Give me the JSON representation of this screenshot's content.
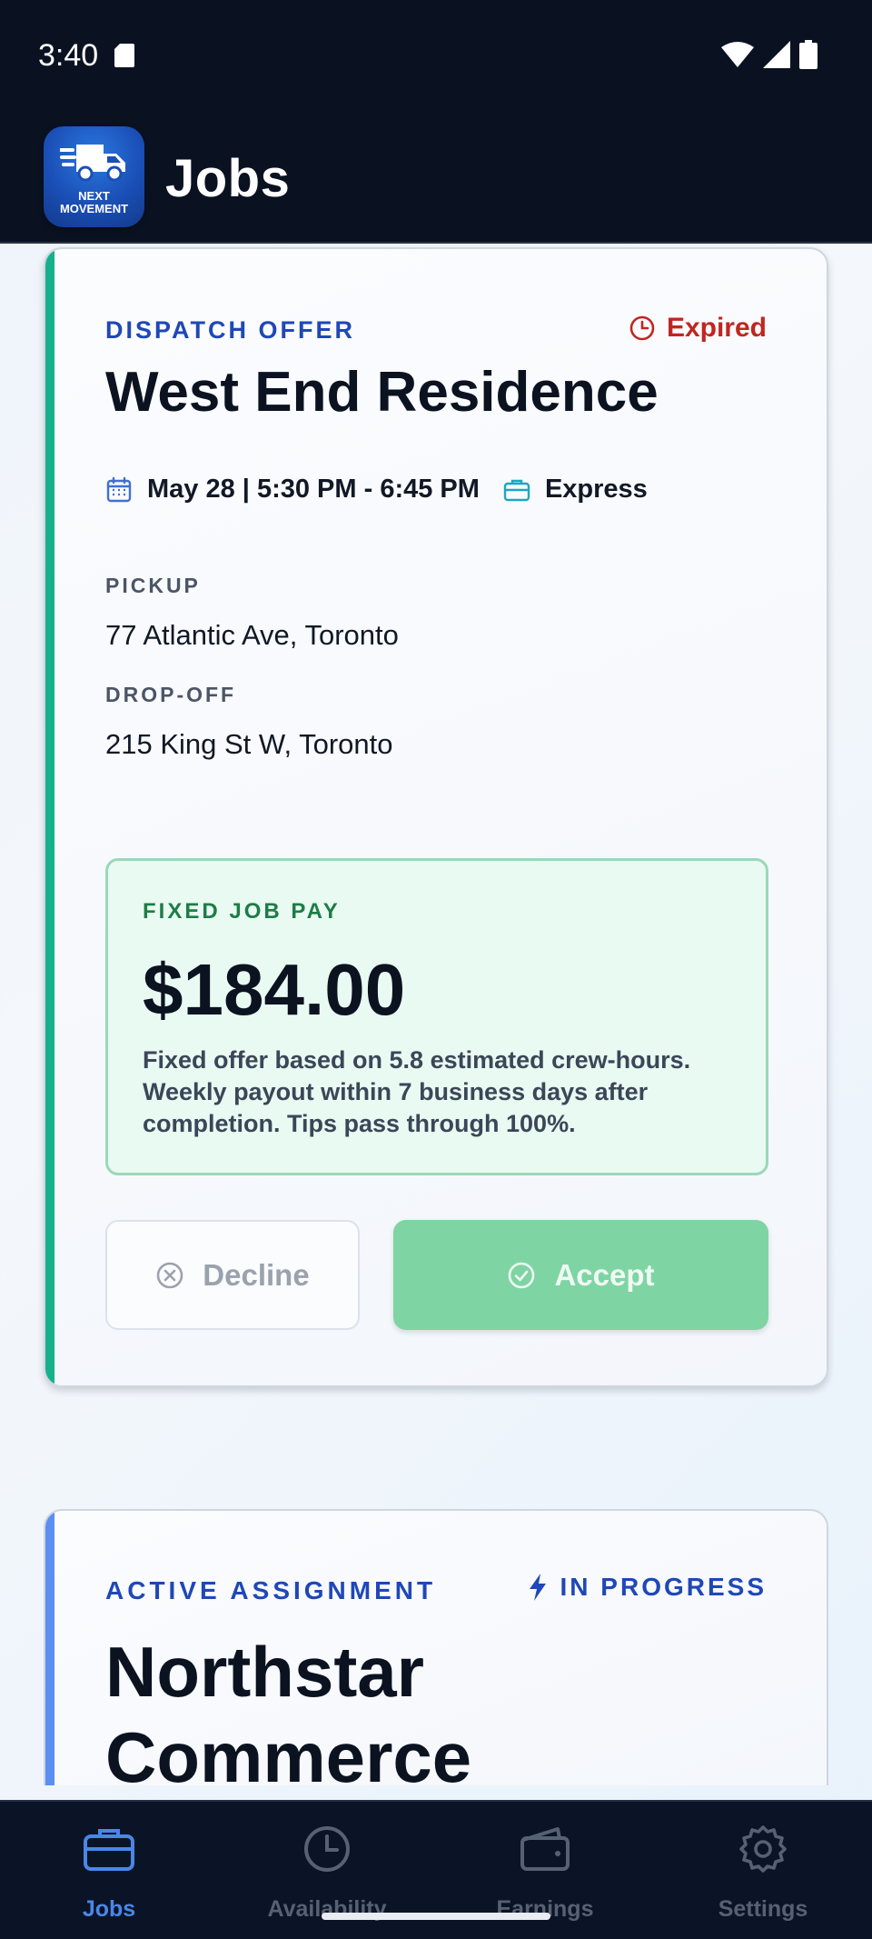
{
  "status_bar": {
    "time": "3:40"
  },
  "header": {
    "title": "Jobs",
    "logo_text_line1": "NEXT",
    "logo_text_line2": "MOVEMENT"
  },
  "offer_card": {
    "eyebrow": "DISPATCH OFFER",
    "status": "Expired",
    "title": "West End Residence",
    "schedule": "May 28 | 5:30 PM - 6:45 PM",
    "service": "Express",
    "pickup_label": "PICKUP",
    "pickup_address": "77 Atlantic Ave, Toronto",
    "dropoff_label": "DROP-OFF",
    "dropoff_address": "215 King St W, Toronto",
    "pay_label": "FIXED JOB PAY",
    "pay_amount": "$184.00",
    "pay_note": "Fixed offer based on 5.8 estimated crew-hours. Weekly payout within 7 business days after completion. Tips pass through 100%.",
    "decline_label": "Decline",
    "accept_label": "Accept",
    "accent_color": "#16b08a",
    "status_color": "#c02621"
  },
  "assignment_card": {
    "eyebrow": "ACTIVE ASSIGNMENT",
    "status": "IN PROGRESS",
    "title": "Northstar Commerce",
    "accent_color": "#5b8ff0"
  },
  "bottom_nav": {
    "items": [
      {
        "label": "Jobs",
        "icon": "briefcase-icon",
        "active": true
      },
      {
        "label": "Availability",
        "icon": "clock-icon",
        "active": false
      },
      {
        "label": "Earnings",
        "icon": "wallet-icon",
        "active": false
      },
      {
        "label": "Settings",
        "icon": "gear-icon",
        "active": false
      }
    ]
  }
}
